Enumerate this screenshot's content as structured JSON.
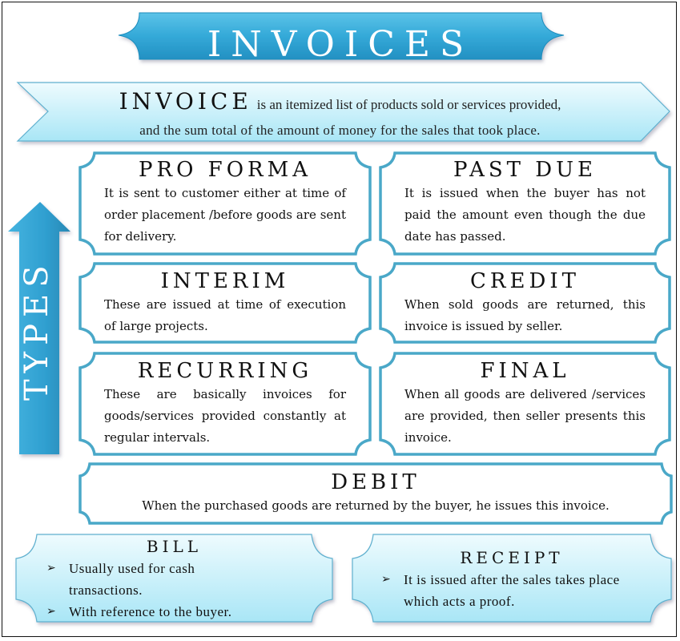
{
  "title": "INVOICES",
  "definition": {
    "term": "INVOICE",
    "line1_rest": "is an itemized list of products sold or services provided,",
    "line2": "and the sum total of the amount of money for the sales that took place."
  },
  "types_label": "TYPES",
  "types": [
    {
      "title": "PRO FORMA",
      "description": "It is sent to customer either at time of order placement /before goods are sent for delivery."
    },
    {
      "title": "PAST DUE",
      "description": "It is issued when the buyer has not paid the amount even though the due date has passed."
    },
    {
      "title": "INTERIM",
      "description": "These are issued at time of execution of large projects."
    },
    {
      "title": "CREDIT",
      "description": "When sold goods are returned, this invoice is issued by seller."
    },
    {
      "title": "RECURRING",
      "description": "These are basically invoices for goods/services provided constantly at regular intervals."
    },
    {
      "title": "FINAL",
      "description": "When all goods are delivered /services are provided, then seller presents this invoice."
    },
    {
      "title": "DEBIT",
      "description": "When the purchased goods are returned by the buyer, he issues this invoice."
    }
  ],
  "bill": {
    "title": "BILL",
    "bullets": [
      "Usually used for cash transactions.",
      "With reference to the buyer."
    ]
  },
  "receipt": {
    "title": "RECEIPT",
    "bullets": [
      "It is issued after the sales takes place which acts a proof."
    ]
  },
  "icons": {
    "bullet": "➢"
  },
  "colors": {
    "banner_blue": "#2fa6d6",
    "card_border": "#4aa8c8",
    "ribbon_light": "#c8f0fa",
    "text": "#111111"
  }
}
